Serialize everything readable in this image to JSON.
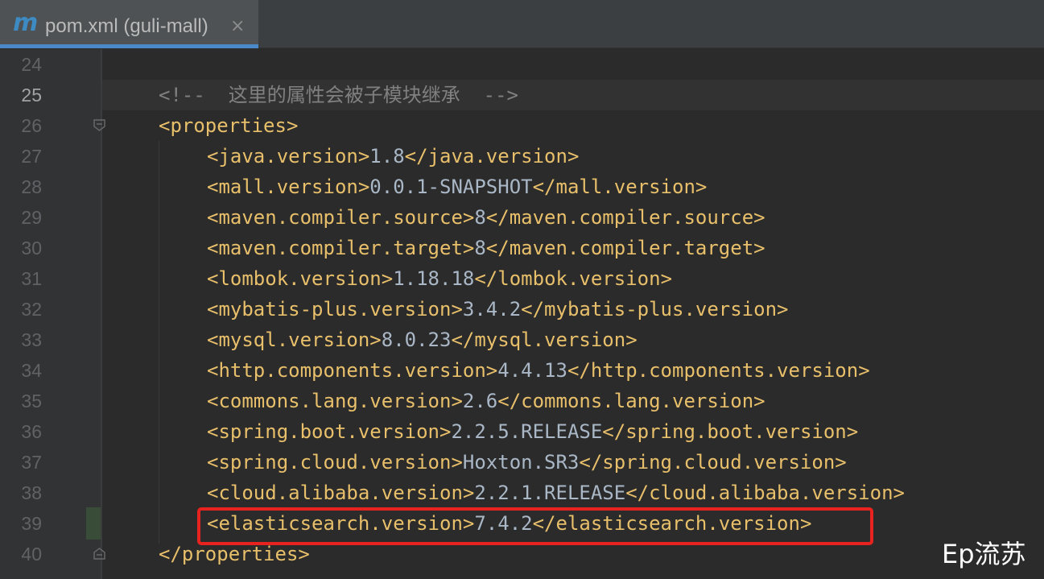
{
  "tab": {
    "icon_letter": "m",
    "title": "pom.xml (guli-mall)",
    "close_glyph": "×"
  },
  "colors": {
    "background": "#2b2b2b",
    "gutter": "#313335",
    "tag": "#e8bf6a",
    "text": "#a9b7c6",
    "comment": "#808080",
    "highlight_box": "#e8221e",
    "tab_accent": "#4a88c7"
  },
  "editor": {
    "current_line": 25,
    "lines": [
      {
        "num": "24"
      },
      {
        "num": "25",
        "comment": "<!--  这里的属性会被子模块继承  -->"
      },
      {
        "num": "26",
        "open": "<properties>"
      },
      {
        "num": "27",
        "tag": "java.version",
        "value": "1.8"
      },
      {
        "num": "28",
        "tag": "mall.version",
        "value": "0.0.1-SNAPSHOT"
      },
      {
        "num": "29",
        "tag": "maven.compiler.source",
        "value": "8"
      },
      {
        "num": "30",
        "tag": "maven.compiler.target",
        "value": "8"
      },
      {
        "num": "31",
        "tag": "lombok.version",
        "value": "1.18.18"
      },
      {
        "num": "32",
        "tag": "mybatis-plus.version",
        "value": "3.4.2"
      },
      {
        "num": "33",
        "tag": "mysql.version",
        "value": "8.0.23"
      },
      {
        "num": "34",
        "tag": "http.components.version",
        "value": "4.4.13"
      },
      {
        "num": "35",
        "tag": "commons.lang.version",
        "value": "2.6"
      },
      {
        "num": "36",
        "tag": "spring.boot.version",
        "value": "2.2.5.RELEASE"
      },
      {
        "num": "37",
        "tag": "spring.cloud.version",
        "value": "Hoxton.SR3"
      },
      {
        "num": "38",
        "tag": "cloud.alibaba.version",
        "value": "2.2.1.RELEASE"
      },
      {
        "num": "39",
        "tag": "elasticsearch.version",
        "value": "7.4.2"
      },
      {
        "num": "40",
        "close": "</properties>"
      }
    ]
  },
  "watermark": "Ep流苏"
}
